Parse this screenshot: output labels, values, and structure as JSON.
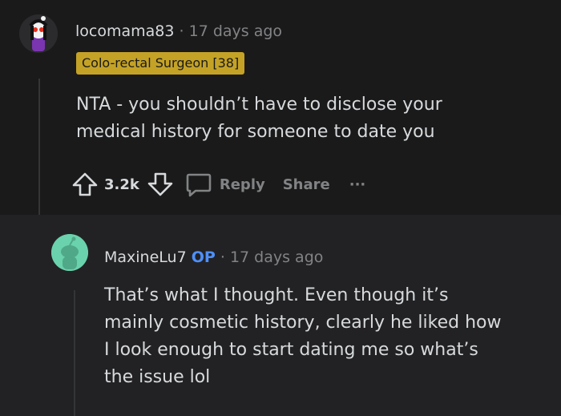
{
  "comment": {
    "author": "locomama83",
    "separator": "·",
    "time": "17 days ago",
    "flair": "Colo-rectal Surgeon [38]",
    "body_lines": [
      "NTA - you shouldn’t have to disclose your",
      "medical history for someone to date you"
    ],
    "votes": "3.2k",
    "reply_label": "Reply",
    "share_label": "Share",
    "more_label": "···"
  },
  "reply": {
    "author": "MaxineLu7",
    "op_label": "OP",
    "separator": "·",
    "time": "17 days ago",
    "body_lines": [
      "That’s what I thought. Even though it’s",
      "mainly cosmetic history, clearly he liked how",
      "I look enough to start dating me so what’s",
      "the issue lol"
    ]
  },
  "colors": {
    "background": "#1a1a1b",
    "reply_background": "#222224",
    "flair": "#c4a226",
    "op": "#4f8ff7",
    "avatar_reply": "#6ad2ac"
  },
  "icons": [
    "user-avatar-icon",
    "upvote-icon",
    "downvote-icon",
    "comment-bubble-icon",
    "snoo-avatar-icon"
  ]
}
